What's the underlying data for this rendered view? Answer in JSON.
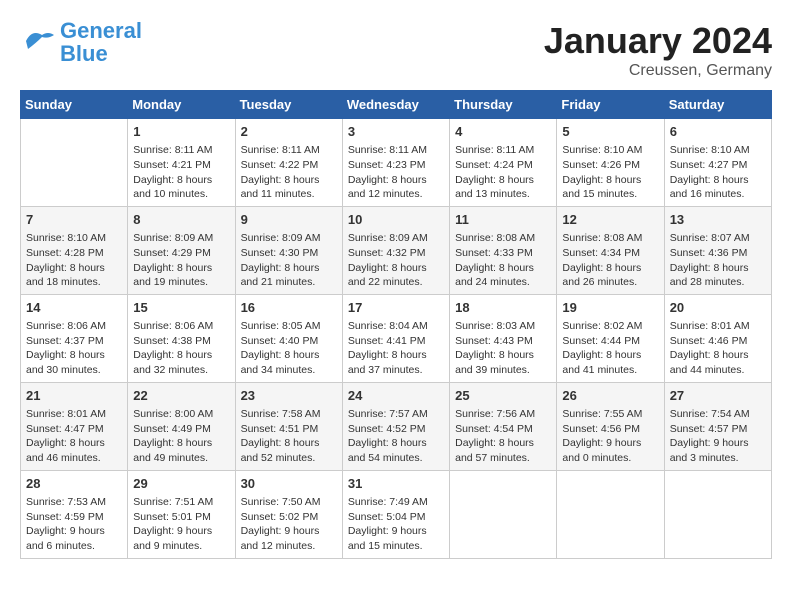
{
  "logo": {
    "text1": "General",
    "text2": "Blue"
  },
  "title": "January 2024",
  "subtitle": "Creussen, Germany",
  "days_of_week": [
    "Sunday",
    "Monday",
    "Tuesday",
    "Wednesday",
    "Thursday",
    "Friday",
    "Saturday"
  ],
  "weeks": [
    [
      {
        "day": "",
        "info": ""
      },
      {
        "day": "1",
        "info": "Sunrise: 8:11 AM\nSunset: 4:21 PM\nDaylight: 8 hours\nand 10 minutes."
      },
      {
        "day": "2",
        "info": "Sunrise: 8:11 AM\nSunset: 4:22 PM\nDaylight: 8 hours\nand 11 minutes."
      },
      {
        "day": "3",
        "info": "Sunrise: 8:11 AM\nSunset: 4:23 PM\nDaylight: 8 hours\nand 12 minutes."
      },
      {
        "day": "4",
        "info": "Sunrise: 8:11 AM\nSunset: 4:24 PM\nDaylight: 8 hours\nand 13 minutes."
      },
      {
        "day": "5",
        "info": "Sunrise: 8:10 AM\nSunset: 4:26 PM\nDaylight: 8 hours\nand 15 minutes."
      },
      {
        "day": "6",
        "info": "Sunrise: 8:10 AM\nSunset: 4:27 PM\nDaylight: 8 hours\nand 16 minutes."
      }
    ],
    [
      {
        "day": "7",
        "info": "Sunrise: 8:10 AM\nSunset: 4:28 PM\nDaylight: 8 hours\nand 18 minutes."
      },
      {
        "day": "8",
        "info": "Sunrise: 8:09 AM\nSunset: 4:29 PM\nDaylight: 8 hours\nand 19 minutes."
      },
      {
        "day": "9",
        "info": "Sunrise: 8:09 AM\nSunset: 4:30 PM\nDaylight: 8 hours\nand 21 minutes."
      },
      {
        "day": "10",
        "info": "Sunrise: 8:09 AM\nSunset: 4:32 PM\nDaylight: 8 hours\nand 22 minutes."
      },
      {
        "day": "11",
        "info": "Sunrise: 8:08 AM\nSunset: 4:33 PM\nDaylight: 8 hours\nand 24 minutes."
      },
      {
        "day": "12",
        "info": "Sunrise: 8:08 AM\nSunset: 4:34 PM\nDaylight: 8 hours\nand 26 minutes."
      },
      {
        "day": "13",
        "info": "Sunrise: 8:07 AM\nSunset: 4:36 PM\nDaylight: 8 hours\nand 28 minutes."
      }
    ],
    [
      {
        "day": "14",
        "info": "Sunrise: 8:06 AM\nSunset: 4:37 PM\nDaylight: 8 hours\nand 30 minutes."
      },
      {
        "day": "15",
        "info": "Sunrise: 8:06 AM\nSunset: 4:38 PM\nDaylight: 8 hours\nand 32 minutes."
      },
      {
        "day": "16",
        "info": "Sunrise: 8:05 AM\nSunset: 4:40 PM\nDaylight: 8 hours\nand 34 minutes."
      },
      {
        "day": "17",
        "info": "Sunrise: 8:04 AM\nSunset: 4:41 PM\nDaylight: 8 hours\nand 37 minutes."
      },
      {
        "day": "18",
        "info": "Sunrise: 8:03 AM\nSunset: 4:43 PM\nDaylight: 8 hours\nand 39 minutes."
      },
      {
        "day": "19",
        "info": "Sunrise: 8:02 AM\nSunset: 4:44 PM\nDaylight: 8 hours\nand 41 minutes."
      },
      {
        "day": "20",
        "info": "Sunrise: 8:01 AM\nSunset: 4:46 PM\nDaylight: 8 hours\nand 44 minutes."
      }
    ],
    [
      {
        "day": "21",
        "info": "Sunrise: 8:01 AM\nSunset: 4:47 PM\nDaylight: 8 hours\nand 46 minutes."
      },
      {
        "day": "22",
        "info": "Sunrise: 8:00 AM\nSunset: 4:49 PM\nDaylight: 8 hours\nand 49 minutes."
      },
      {
        "day": "23",
        "info": "Sunrise: 7:58 AM\nSunset: 4:51 PM\nDaylight: 8 hours\nand 52 minutes."
      },
      {
        "day": "24",
        "info": "Sunrise: 7:57 AM\nSunset: 4:52 PM\nDaylight: 8 hours\nand 54 minutes."
      },
      {
        "day": "25",
        "info": "Sunrise: 7:56 AM\nSunset: 4:54 PM\nDaylight: 8 hours\nand 57 minutes."
      },
      {
        "day": "26",
        "info": "Sunrise: 7:55 AM\nSunset: 4:56 PM\nDaylight: 9 hours\nand 0 minutes."
      },
      {
        "day": "27",
        "info": "Sunrise: 7:54 AM\nSunset: 4:57 PM\nDaylight: 9 hours\nand 3 minutes."
      }
    ],
    [
      {
        "day": "28",
        "info": "Sunrise: 7:53 AM\nSunset: 4:59 PM\nDaylight: 9 hours\nand 6 minutes."
      },
      {
        "day": "29",
        "info": "Sunrise: 7:51 AM\nSunset: 5:01 PM\nDaylight: 9 hours\nand 9 minutes."
      },
      {
        "day": "30",
        "info": "Sunrise: 7:50 AM\nSunset: 5:02 PM\nDaylight: 9 hours\nand 12 minutes."
      },
      {
        "day": "31",
        "info": "Sunrise: 7:49 AM\nSunset: 5:04 PM\nDaylight: 9 hours\nand 15 minutes."
      },
      {
        "day": "",
        "info": ""
      },
      {
        "day": "",
        "info": ""
      },
      {
        "day": "",
        "info": ""
      }
    ]
  ]
}
